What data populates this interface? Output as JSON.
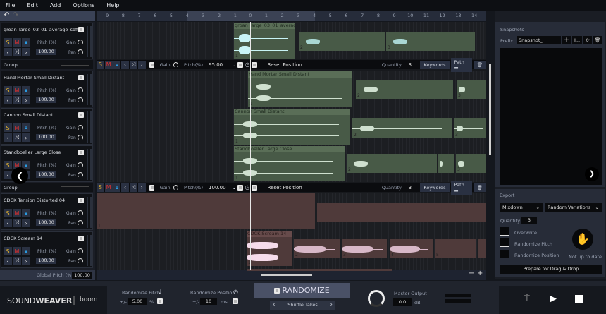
{
  "menu": [
    "File",
    "Edit",
    "Add",
    "Options",
    "Help"
  ],
  "ruler": {
    "ticks": [
      "-9",
      "-8",
      "-7",
      "-6",
      "-5",
      "-4",
      "-3",
      "-2",
      "-1",
      "0",
      "1",
      "2",
      "3",
      "4",
      "5",
      "6",
      "7",
      "8",
      "9",
      "10",
      "11",
      "12",
      "13",
      "14"
    ]
  },
  "tracks": [
    {
      "name": "groan_large_03_01_average_soft",
      "pitch": "100.00"
    },
    {
      "name": "Hand Mortar Small Distant",
      "pitch": "100.00"
    },
    {
      "name": "Cannon Small Distant",
      "pitch": "100.00"
    },
    {
      "name": "Standboeller Large Close",
      "pitch": "100.00"
    },
    {
      "name": "CDCK Tension Distorted 04",
      "pitch": "100.00"
    },
    {
      "name": "CDCK Scream 14",
      "pitch": "100.00"
    }
  ],
  "labels": {
    "S": "S",
    "M": "M",
    "pitch": "Pitch (%)",
    "gain": "Gain",
    "pan": "Pan",
    "group": "Group",
    "global_pitch": "Global Pitch (%)",
    "global_pitch_value": "100.00"
  },
  "group_toolbar": [
    {
      "gain": "Gain",
      "pitch_label": "Pitch(%)",
      "pitch": "95.00",
      "reset": "Reset Position",
      "quantity_label": "Quantity:",
      "quantity": "3",
      "keywords": "Keywords",
      "path": "Path"
    },
    {
      "gain": "Gain",
      "pitch_label": "Pitch(%)",
      "pitch": "100.00",
      "reset": "Reset Position",
      "quantity_label": "Quantity:",
      "quantity": "3",
      "keywords": "Keywords",
      "path": "Path"
    }
  ],
  "clips": {
    "groan": "groan_large_03_01_average...",
    "mortar": "Hand Mortar Small Distant",
    "cannon": "Cannon Small Distant",
    "stand": "Standboeller Large Close",
    "scream": "CDCK Scream 14",
    "n1": "1",
    "n2": "2",
    "n3": "3",
    "n4": "4",
    "n5": "5"
  },
  "snapshots": {
    "title": "Snapshots",
    "prefix_label": "Prefix:",
    "prefix_value": "Snapshot_",
    "rename": "I..."
  },
  "export": {
    "title": "Export",
    "mode": "Mixdown",
    "type": "Random Variations",
    "quantity_label": "Quantity",
    "quantity": "3",
    "overwrite": "Overwrite",
    "rand_pitch": "Randomize Pitch",
    "rand_pos": "Randomize Position",
    "status": "Not up to date",
    "prepare": "Prepare for Drag & Drop"
  },
  "bottom": {
    "logo_a": "SOUND",
    "logo_b": "WEAVER",
    "brand": "boom",
    "rand_pitch_label": "Randomize Pitch",
    "pm": "+/-",
    "rand_pitch": "5.00",
    "pct": "%",
    "rand_pos_label": "Randomize Position",
    "rand_pos": "10",
    "ms": "ms",
    "randomize": "RANDOMIZE",
    "shuffle": "Shuffle Takes",
    "master_label": "Master Output",
    "master": "0.0",
    "db": "dB"
  },
  "colors": {
    "clip_green": "#485a47",
    "clip_pink": "#4f3a3a",
    "solo": "#e0b030",
    "mute": "#e03030",
    "lock": "#2a9ae0"
  }
}
